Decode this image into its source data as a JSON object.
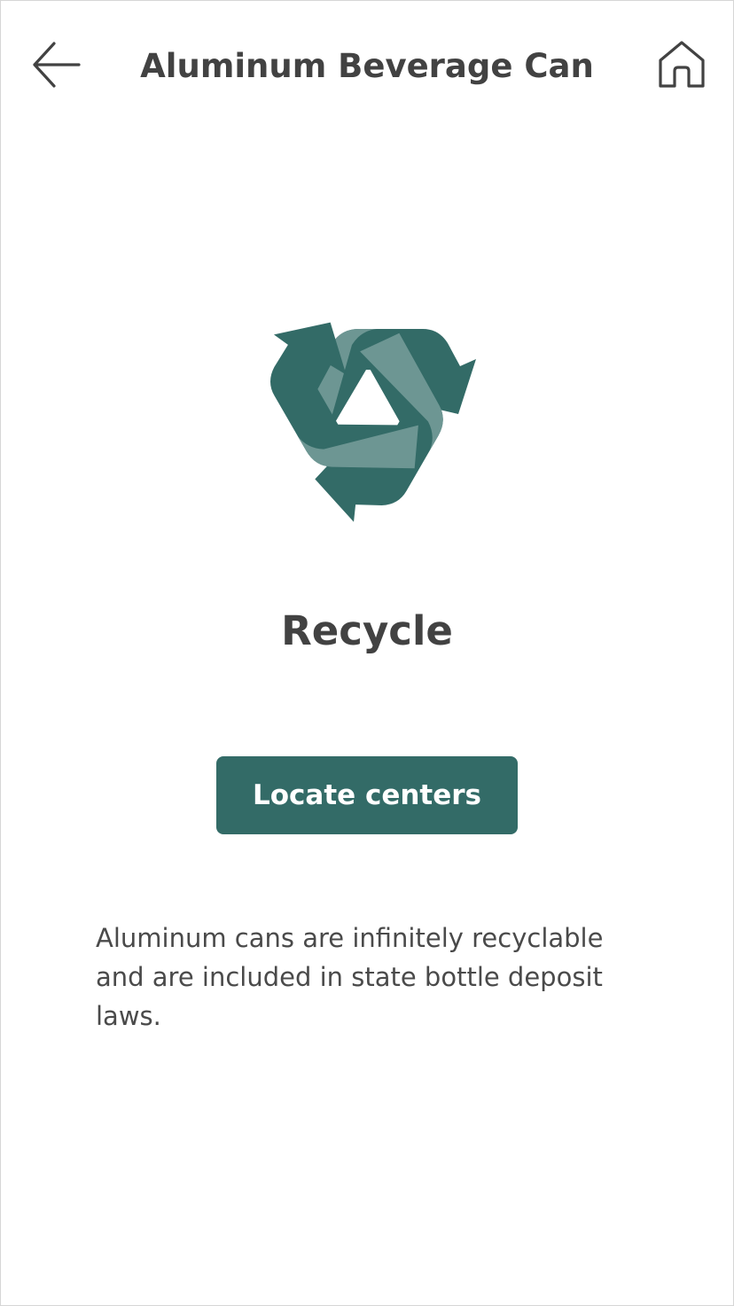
{
  "header": {
    "title": "Aluminum Beverage Can",
    "back_icon": "arrow-left-icon",
    "home_icon": "home-icon"
  },
  "disposal": {
    "icon": "recycle-icon",
    "method": "Recycle",
    "action_label": "Locate centers",
    "description": "Aluminum cans are infinitely recyclable and are included in state bottle deposit laws."
  },
  "colors": {
    "accent": "#336b67",
    "accent_light": "#6d9693",
    "text": "#424242",
    "background": "#ffffff"
  }
}
